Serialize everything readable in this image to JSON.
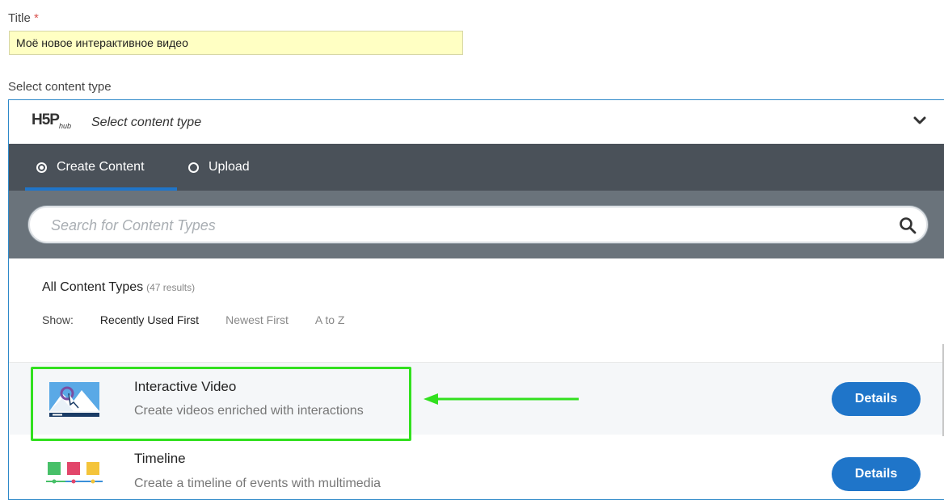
{
  "form": {
    "title_label": "Title",
    "title_required": "*",
    "title_value": "Моё новое интерактивное видео",
    "content_type_label": "Select content type"
  },
  "hub": {
    "logo": "H5P",
    "logo_sub": "hub",
    "header_title": "Select content type",
    "tabs": [
      {
        "label": "Create Content",
        "selected": true
      },
      {
        "label": "Upload",
        "selected": false
      }
    ],
    "search_placeholder": "Search for Content Types",
    "results_title": "All Content Types",
    "results_count": "(47 results)",
    "show_label": "Show:",
    "sort_options": [
      "Recently Used First",
      "Newest First",
      "A to Z"
    ],
    "items": [
      {
        "title": "Interactive Video",
        "description": "Create videos enriched with interactions",
        "button": "Details",
        "icon": "interactive-video-icon"
      },
      {
        "title": "Timeline",
        "description": "Create a timeline of events with multimedia",
        "button": "Details",
        "icon": "timeline-icon"
      }
    ]
  },
  "colors": {
    "accent": "#1f75c9",
    "tabbar": "#4a5159",
    "searchband": "#6a737b",
    "highlight": "#32e01f",
    "title_field": "#ffffc3"
  }
}
